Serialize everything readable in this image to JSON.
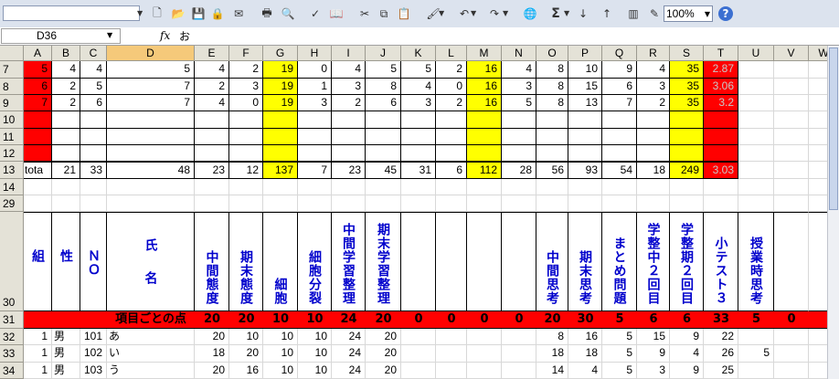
{
  "toolbar": {
    "zoom": "100%",
    "icons": [
      "new-icon",
      "open-icon",
      "save-icon",
      "permission-icon",
      "email-icon",
      "print-icon",
      "print-preview-icon",
      "spelling-icon",
      "research-icon",
      "cut-icon",
      "copy-icon",
      "paste-icon",
      "format-painter-icon",
      "undo-icon",
      "redo-icon",
      "hyperlink-icon",
      "autosum-icon",
      "sort-ascending-icon",
      "sort-descending-icon",
      "chart-wizard-icon",
      "drawing-icon",
      "help-icon"
    ]
  },
  "formula_bar": {
    "name_box": "D36",
    "fx": "fx",
    "value": "お"
  },
  "colors": {
    "red": "#ff0000",
    "yellow": "#ffff00",
    "header_bg": "#e4e2d7",
    "header_text": "#0000cc"
  },
  "columns": [
    "A",
    "B",
    "C",
    "D",
    "E",
    "F",
    "G",
    "H",
    "I",
    "J",
    "K",
    "L",
    "M",
    "N",
    "O",
    "P",
    "Q",
    "R",
    "S",
    "T",
    "U",
    "V",
    "W"
  ],
  "row_numbers": [
    "7",
    "8",
    "9",
    "10",
    "11",
    "12",
    "13",
    "14",
    "29",
    "30",
    "31",
    "32",
    "33",
    "34"
  ],
  "rows": [
    {
      "r": "7",
      "cells": {
        "A": "5",
        "B": "4",
        "C": "4",
        "D": "5",
        "E": "4",
        "F": "2",
        "G": "19",
        "H": "0",
        "I": "4",
        "J": "5",
        "K": "5",
        "L": "2",
        "M": "16",
        "N": "4",
        "O": "8",
        "P": "10",
        "Q": "9",
        "R": "4",
        "S": "35",
        "T": "2.87"
      }
    },
    {
      "r": "8",
      "cells": {
        "A": "6",
        "B": "2",
        "C": "5",
        "D": "7",
        "E": "2",
        "F": "3",
        "G": "19",
        "H": "1",
        "I": "3",
        "J": "8",
        "K": "4",
        "L": "0",
        "M": "16",
        "N": "3",
        "O": "8",
        "P": "15",
        "Q": "6",
        "R": "3",
        "S": "35",
        "T": "3.06"
      }
    },
    {
      "r": "9",
      "cells": {
        "A": "7",
        "B": "2",
        "C": "6",
        "D": "7",
        "E": "4",
        "F": "0",
        "G": "19",
        "H": "3",
        "I": "2",
        "J": "6",
        "K": "3",
        "L": "2",
        "M": "16",
        "N": "5",
        "O": "8",
        "P": "13",
        "Q": "7",
        "R": "2",
        "S": "35",
        "T": "3.2"
      }
    },
    {
      "r": "10",
      "cells": {}
    },
    {
      "r": "11",
      "cells": {}
    },
    {
      "r": "12",
      "cells": {}
    },
    {
      "r": "13",
      "cells": {
        "A": "tota",
        "B": "21",
        "C": "33",
        "D": "48",
        "E": "23",
        "F": "12",
        "G": "137",
        "H": "7",
        "I": "23",
        "J": "45",
        "K": "31",
        "L": "6",
        "M": "112",
        "N": "28",
        "O": "56",
        "P": "93",
        "Q": "54",
        "R": "18",
        "S": "249",
        "T": "3.03"
      }
    },
    {
      "r": "14",
      "cells": {}
    },
    {
      "r": "29",
      "cells": {}
    }
  ],
  "headers30": {
    "A": "組",
    "B": "性",
    "C": "ＮＯ",
    "D": "氏名",
    "E": "中間態度",
    "F": "期末態度",
    "G": "細胞",
    "H": "細胞分裂",
    "I": "中間学習整理",
    "J": "期末学習整理",
    "O": "中間思考",
    "P": "期末思考",
    "Q": "まとめ問題",
    "R": "学整中２回目",
    "S": "学整期２回目",
    "T": "小テスト３",
    "U": "授業時思考"
  },
  "row31": {
    "label": "項目ごとの点",
    "cells": {
      "E": "20",
      "F": "20",
      "G": "10",
      "H": "10",
      "I": "24",
      "J": "20",
      "K": "0",
      "L": "0",
      "M": "0",
      "N": "0",
      "O": "20",
      "P": "30",
      "Q": "5",
      "R": "6",
      "S": "6",
      "T": "33",
      "U": "5",
      "V": "0"
    }
  },
  "students": [
    {
      "r": "32",
      "cells": {
        "A": "1",
        "B": "男",
        "C": "101",
        "D": "あ",
        "E": "20",
        "F": "10",
        "G": "10",
        "H": "10",
        "I": "24",
        "J": "20",
        "O": "8",
        "P": "16",
        "Q": "5",
        "R": "15",
        "S": "9",
        "T": "22"
      }
    },
    {
      "r": "33",
      "cells": {
        "A": "1",
        "B": "男",
        "C": "102",
        "D": "い",
        "E": "18",
        "F": "20",
        "G": "10",
        "H": "10",
        "I": "24",
        "J": "20",
        "O": "18",
        "P": "18",
        "Q": "5",
        "R": "9",
        "S": "4",
        "T": "26",
        "U": "5"
      }
    },
    {
      "r": "34",
      "cells": {
        "A": "1",
        "B": "男",
        "C": "103",
        "D": "う",
        "E": "20",
        "F": "16",
        "G": "10",
        "H": "10",
        "I": "24",
        "J": "20",
        "O": "14",
        "P": "4",
        "Q": "5",
        "R": "3",
        "S": "9",
        "T": "25"
      }
    }
  ]
}
